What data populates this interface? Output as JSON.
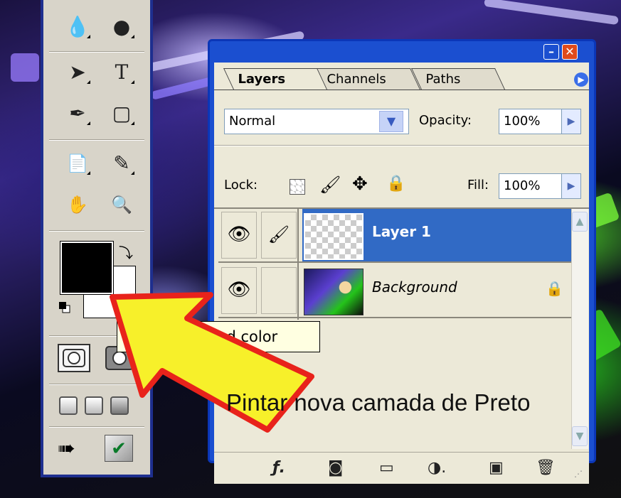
{
  "toolbox": {
    "tools": [
      {
        "name": "blur-tool",
        "glyph": "💧"
      },
      {
        "name": "dodge-tool",
        "glyph": "●"
      },
      {
        "name": "path-selection-tool",
        "glyph": "➤"
      },
      {
        "name": "type-tool",
        "glyph": "T"
      },
      {
        "name": "pen-tool",
        "glyph": "✒"
      },
      {
        "name": "shape-tool",
        "glyph": "▢"
      },
      {
        "name": "notes-tool",
        "glyph": "📄"
      },
      {
        "name": "eyedropper-tool",
        "glyph": "✎"
      },
      {
        "name": "hand-tool",
        "glyph": "✋"
      },
      {
        "name": "zoom-tool",
        "glyph": "🔍"
      }
    ],
    "foreground_color": "#000000",
    "background_color": "#ffffff"
  },
  "tooltip": {
    "text": "Set foreground color"
  },
  "layers_panel": {
    "tabs": [
      "Layers",
      "Channels",
      "Paths"
    ],
    "blend_mode": "Normal",
    "opacity_label": "Opacity:",
    "opacity_value": "100%",
    "lock_label": "Lock:",
    "fill_label": "Fill:",
    "fill_value": "100%",
    "layers": [
      {
        "name": "Layer 1",
        "selected": true,
        "visible": true
      },
      {
        "name": "Background",
        "selected": false,
        "visible": true,
        "locked": true
      }
    ]
  },
  "caption": "Pintar nova camada de Preto",
  "colors": {
    "accent": "#316ac5",
    "window_frame": "#1b4fd0",
    "arrow_fill": "#f7f02a",
    "arrow_outline": "#e8231b"
  }
}
